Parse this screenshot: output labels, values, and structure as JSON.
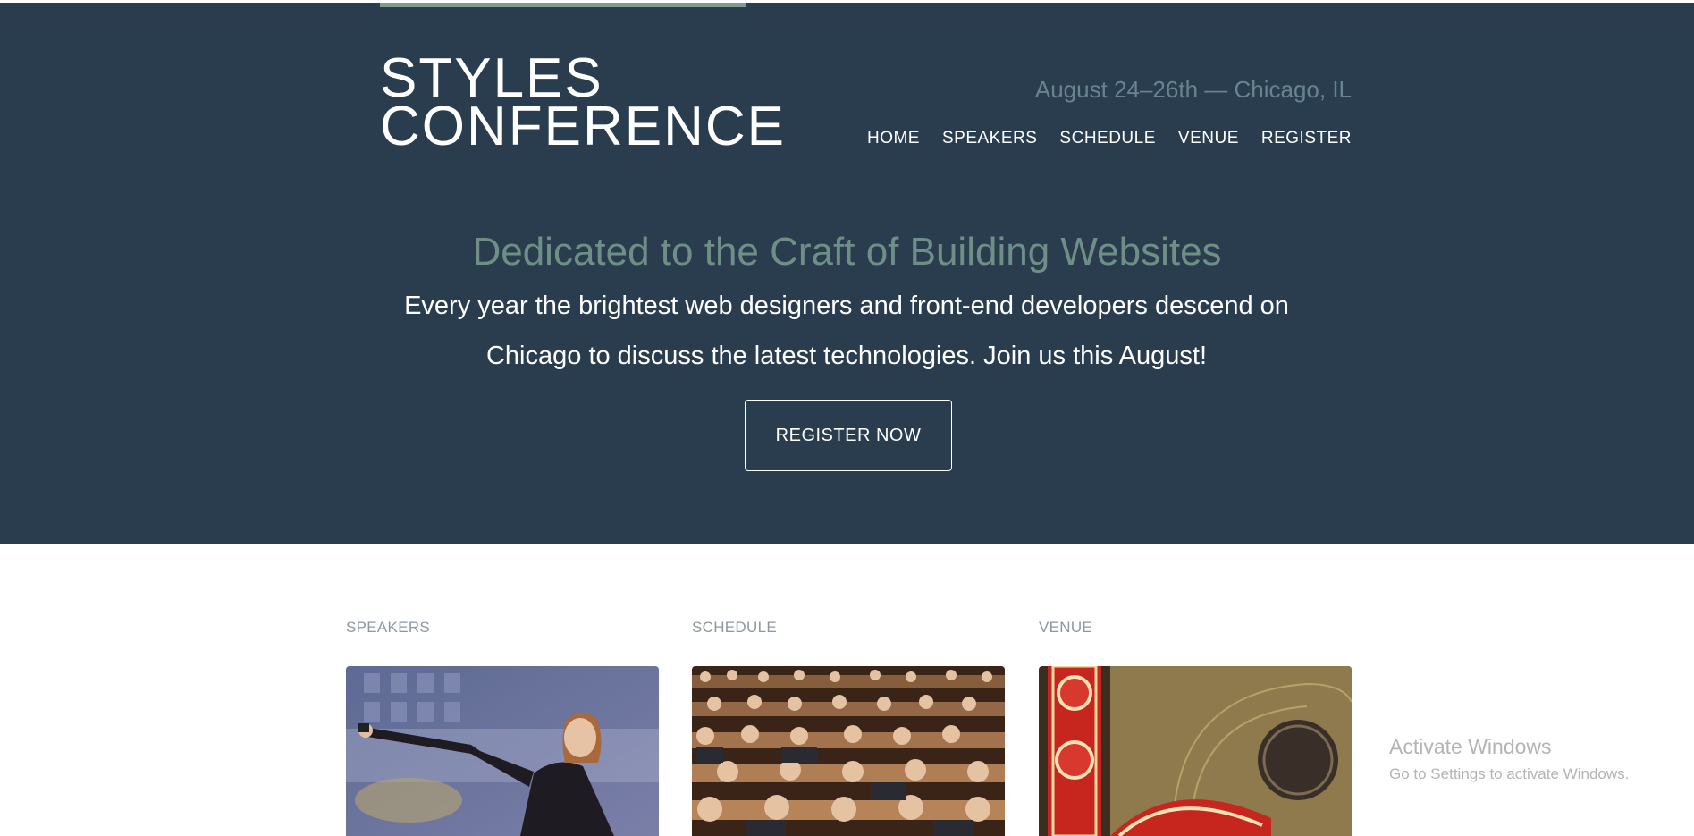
{
  "header": {
    "logo_line1": "STYLES",
    "logo_line2": "CONFERENCE",
    "dates": "August 24–26th — Chicago, IL",
    "nav": [
      {
        "label": "HOME"
      },
      {
        "label": "SPEAKERS"
      },
      {
        "label": "SCHEDULE"
      },
      {
        "label": "VENUE"
      },
      {
        "label": "REGISTER"
      }
    ]
  },
  "hero": {
    "tagline": "Dedicated to the Craft of Building Websites",
    "lead_line1": "Every year the brightest web designers and front-end developers descend on",
    "lead_line2": "Chicago to discuss the latest technologies. Join us this August!",
    "cta_label": "REGISTER NOW"
  },
  "sections": [
    {
      "title": "SPEAKERS",
      "image": "speaker-presenting-photo"
    },
    {
      "title": "SCHEDULE",
      "image": "audience-seating-photo"
    },
    {
      "title": "VENUE",
      "image": "chicago-theatre-sign-photo"
    }
  ],
  "watermark": {
    "title": "Activate Windows",
    "subtitle": "Go to Settings to activate Windows."
  },
  "colors": {
    "hero_bg": "#293d4f",
    "accent": "#7f9c91",
    "tagline": "#6f8f86"
  }
}
